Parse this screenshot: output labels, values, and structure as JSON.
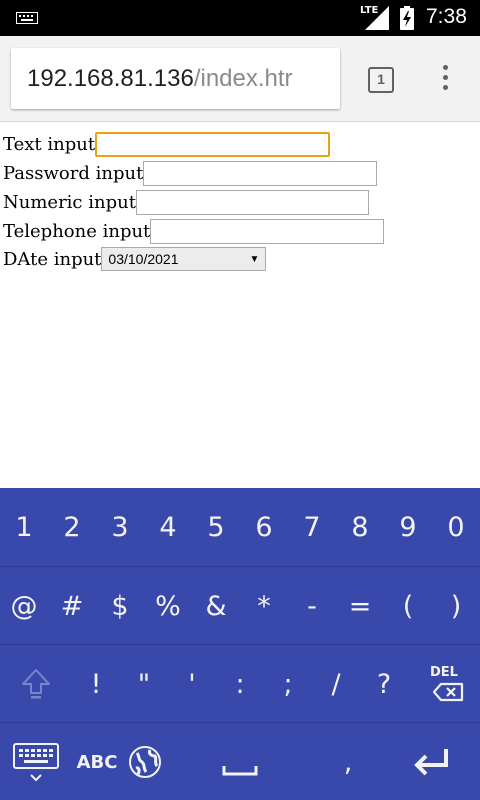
{
  "status_bar": {
    "network": "LTE",
    "time": "7:38",
    "icons": [
      "keyboard-icon",
      "signal-icon",
      "battery-charging-icon"
    ]
  },
  "browser": {
    "url_host": "192.168.81.136",
    "url_path": "/index.htr",
    "tab_count": "1",
    "icons": [
      "tab-switcher-icon",
      "overflow-menu-icon"
    ]
  },
  "form": {
    "text_label": "Text input",
    "password_label": "Password input",
    "numeric_label": "Numeric input",
    "telephone_label": "Telephone input",
    "date_label": "DAte input",
    "date_value": "03/10/2021",
    "text_value": "",
    "password_value": "",
    "numeric_value": "",
    "telephone_value": ""
  },
  "keyboard": {
    "colors": {
      "background": "#3949ab",
      "key_text": "#f2f2f2",
      "dim_key": "#7986cb"
    },
    "row1": [
      "1",
      "2",
      "3",
      "4",
      "5",
      "6",
      "7",
      "8",
      "9",
      "0"
    ],
    "row2": [
      "@",
      "#",
      "$",
      "%",
      "&",
      "*",
      "-",
      "=",
      "(",
      ")"
    ],
    "row3": [
      "!",
      "\"",
      "'",
      ":",
      ";",
      "/",
      "?"
    ],
    "abc_label": "ABC",
    "comma_label": ",",
    "icons": [
      "shift-icon",
      "delete-icon",
      "keyboard-switch-icon",
      "globe-icon",
      "space-icon",
      "enter-icon"
    ]
  }
}
